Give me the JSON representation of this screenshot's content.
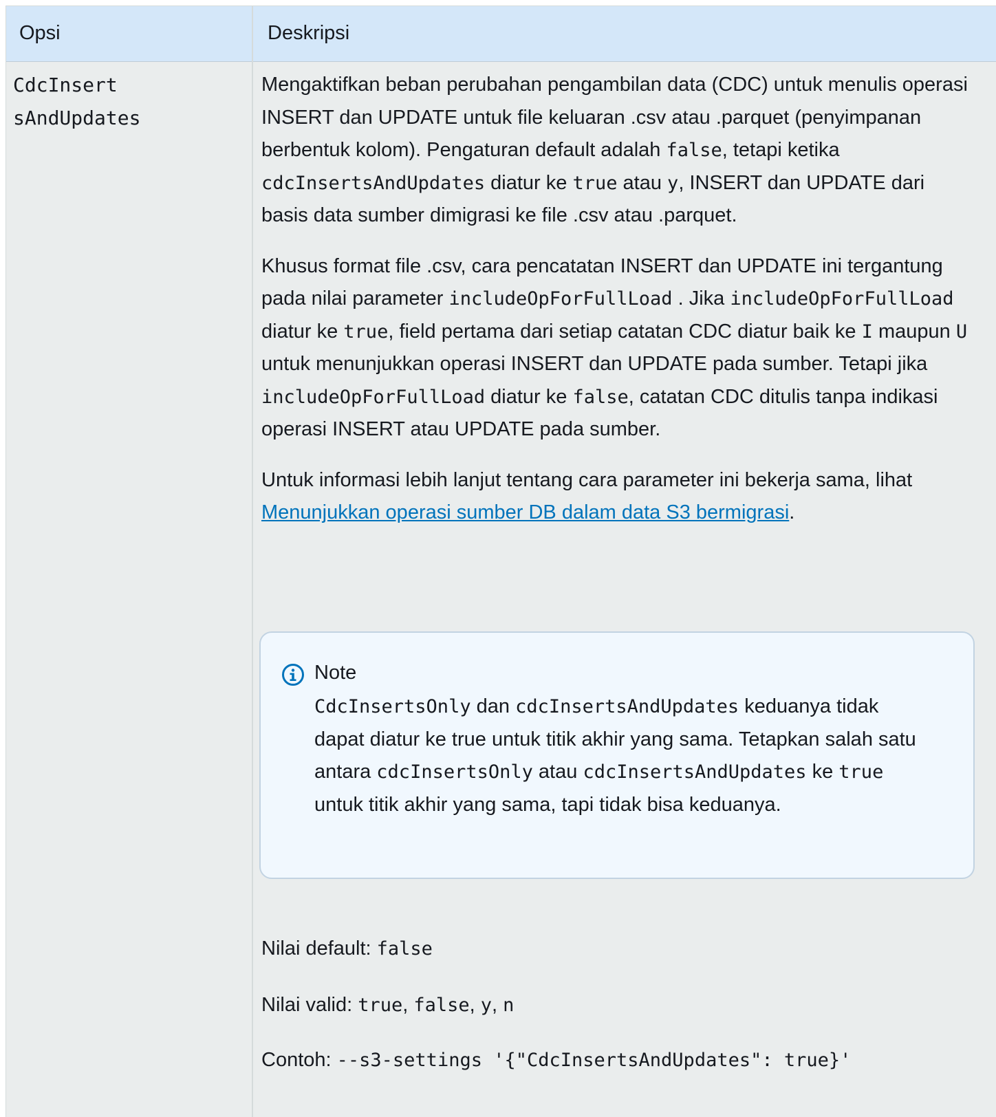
{
  "table": {
    "headers": {
      "opsi": "Opsi",
      "deskripsi": "Deskripsi"
    },
    "row": {
      "opsi_line1": "CdcInsert",
      "opsi_line2": "sAndUpdates",
      "p1": {
        "t1": "Mengaktifkan beban perubahan pengambilan data (CDC) untuk menulis operasi INSERT dan UPDATE untuk file keluaran .csv atau .parquet (penyimpanan berbentuk kolom). Pengaturan default adalah ",
        "c1": "false",
        "t2": ", tetapi ketika ",
        "c2": "cdcInsertsAndUpdates",
        "t3": " diatur ke ",
        "c3": "true",
        "t4": " atau ",
        "c4": "y",
        "t5": ", INSERT dan UPDATE dari basis data sumber dimigrasi ke file .csv atau .parquet."
      },
      "p2": {
        "t1": "Khusus format file .csv, cara pencatatan INSERT dan UPDATE ini tergantung pada nilai parameter ",
        "c1": "includeOpForFullLoad",
        "t2": " . Jika ",
        "c2": "includeOpForFullLoad",
        "t3": " diatur ke ",
        "c3": "true",
        "t4": ", field pertama dari setiap catatan CDC diatur baik ke ",
        "c4": "I",
        "t5": " maupun ",
        "c5": "U",
        "t6": " untuk menunjukkan operasi INSERT dan UPDATE pada sumber. Tetapi jika ",
        "c6": "includeOpForFullLoad",
        "t7": " diatur ke ",
        "c7": "false",
        "t8": ", catatan CDC ditulis tanpa indikasi operasi INSERT atau UPDATE pada sumber."
      },
      "p3": {
        "t1": "Untuk informasi lebih lanjut tentang cara parameter ini bekerja sama, lihat ",
        "link": "Menunjukkan operasi sumber DB dalam data S3 bermigrasi",
        "t2": "."
      },
      "note": {
        "title": "Note",
        "c1": "CdcInsertsOnly",
        "t1": " dan ",
        "c2": "cdcInsertsAndUpdates",
        "t2": " keduanya tidak dapat diatur ke true untuk titik akhir yang sama. Tetapkan salah satu antara ",
        "c3": "cdcInsertsOnly",
        "t3": " atau ",
        "c4": "cdcInsertsAndUpdates",
        "t4": " ke ",
        "c5": "true",
        "t5": " untuk titik akhir yang sama, tapi tidak bisa keduanya."
      },
      "default": {
        "label": "Nilai default: ",
        "value": "false"
      },
      "valid": {
        "label": "Nilai valid: ",
        "v1": "true",
        "s1": ", ",
        "v2": "false",
        "s2": ", ",
        "v3": "y",
        "s3": ", ",
        "v4": "n"
      },
      "example": {
        "label": "Contoh: ",
        "code": "--s3-settings '{\"CdcInsertsAndUpdates\": true}'"
      }
    }
  },
  "icons": {
    "note": "info-circle-icon"
  },
  "colors": {
    "header_bg": "#d4e7f9",
    "row_bg": "#eaeded",
    "note_bg": "#f1f8fe",
    "link": "#0073bb",
    "info_icon": "#0073bb"
  }
}
